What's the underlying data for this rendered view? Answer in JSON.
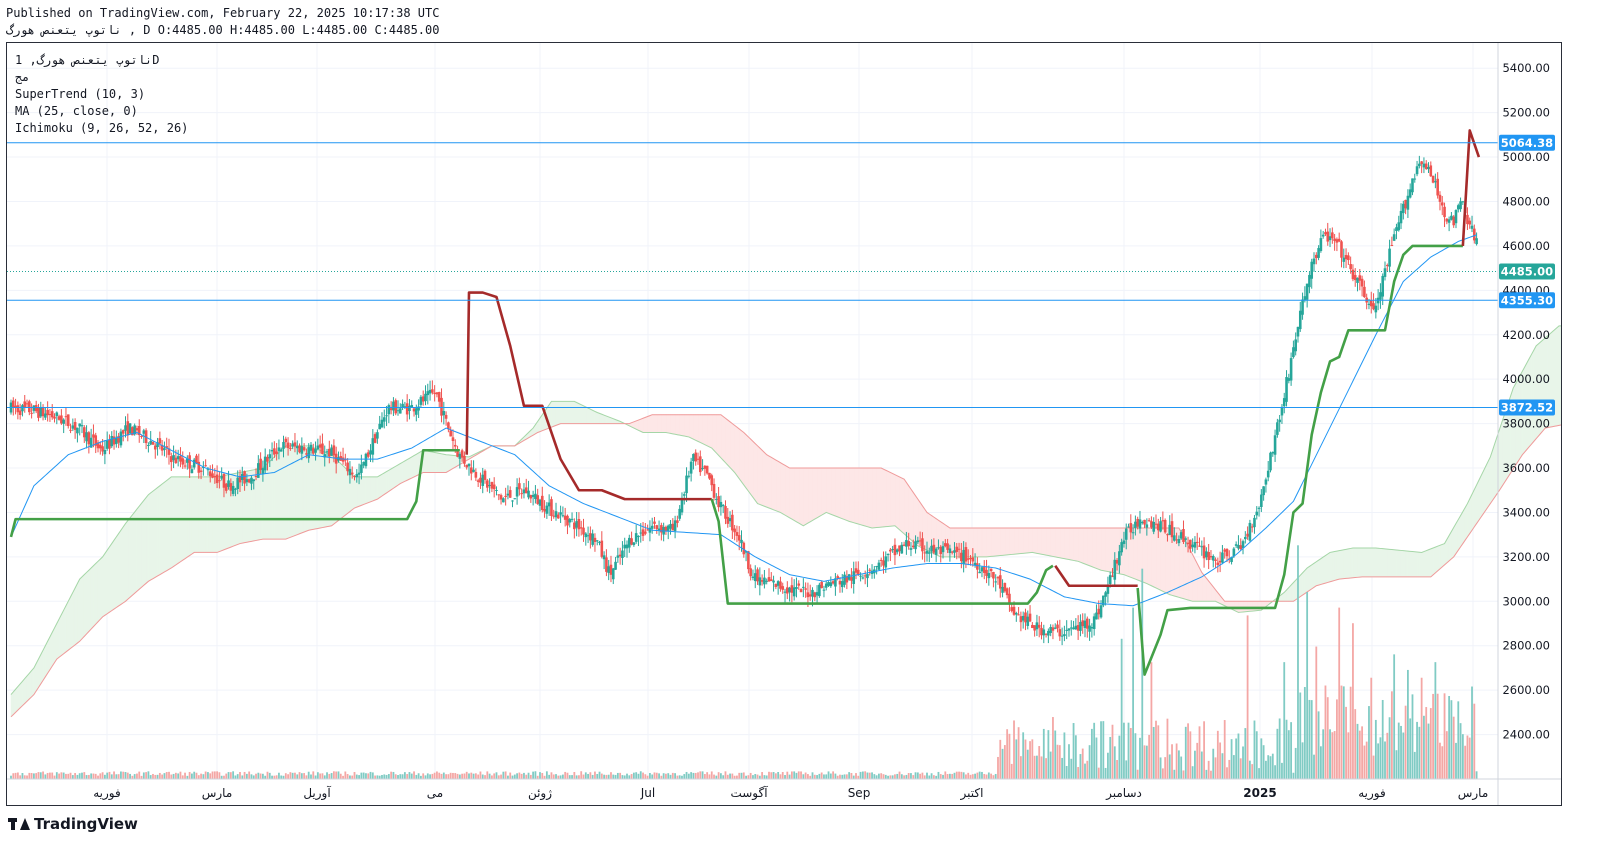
{
  "header": {
    "published": "Published on TradingView.com, February 22, 2025 10:17:38 UTC",
    "ohlc": "ناتوپ یتعنص هورگ , D O:4485.00 H:4485.00 L:4485.00 C:4485.00"
  },
  "legend": {
    "symbol": "ناتوپ یتعنص هورگ, 1D",
    "exchange": "مج",
    "supertrend": "SuperTrend (10, 3)",
    "ma": "MA (25, close, 0)",
    "ichimoku": "Ichimoku (9, 26, 52, 26)"
  },
  "footer": {
    "brand": "TradingView"
  },
  "colors": {
    "up": "#26a69a",
    "down": "#ef5350",
    "supertrend_up": "#43a047",
    "supertrend_down": "#a52a2a",
    "ma": "#2196f3",
    "cloud_bull": "#e8f5e9",
    "cloud_bear": "#fde7e7",
    "hline": "#2196f3"
  },
  "chart_data": {
    "type": "candlestick",
    "ylim": [
      2200,
      5500
    ],
    "y_ticks": [
      2400,
      2600,
      2800,
      3000,
      3200,
      3400,
      3600,
      3800,
      4000,
      4200,
      4400,
      4600,
      4800,
      5000,
      5200,
      5400
    ],
    "x_labels": [
      "فوریه",
      "مارس",
      "آوریل",
      "می",
      "ژوئن",
      "Jul",
      "آگوست",
      "Sep",
      "اکتبر",
      "دسامبر",
      "2025",
      "فوریه",
      "مارس"
    ],
    "x_label_bold": "2025",
    "horizontal_lines": [
      5064.38,
      4355.3,
      3872.52
    ],
    "price_labels": [
      {
        "value": 5064.38,
        "text": "5064.38",
        "color": "#2196f3"
      },
      {
        "value": 4485.0,
        "text": "4485.00",
        "color": "#26a69a"
      },
      {
        "value": 4355.3,
        "text": "4355.30",
        "color": "#2196f3"
      },
      {
        "value": 3872.52,
        "text": "3872.52",
        "color": "#2196f3"
      }
    ],
    "last_price": 4485.0,
    "price_anchors": [
      [
        0,
        3870
      ],
      [
        10,
        3860
      ],
      [
        20,
        3830
      ],
      [
        30,
        3780
      ],
      [
        40,
        3680
      ],
      [
        52,
        3780
      ],
      [
        62,
        3720
      ],
      [
        72,
        3640
      ],
      [
        85,
        3600
      ],
      [
        95,
        3520
      ],
      [
        105,
        3560
      ],
      [
        118,
        3700
      ],
      [
        128,
        3690
      ],
      [
        140,
        3670
      ],
      [
        152,
        3560
      ],
      [
        165,
        3870
      ],
      [
        175,
        3870
      ],
      [
        186,
        3940
      ],
      [
        190,
        3820
      ],
      [
        196,
        3660
      ],
      [
        205,
        3560
      ],
      [
        215,
        3460
      ],
      [
        225,
        3500
      ],
      [
        235,
        3420
      ],
      [
        245,
        3360
      ],
      [
        256,
        3280
      ],
      [
        262,
        3120
      ],
      [
        271,
        3280
      ],
      [
        281,
        3340
      ],
      [
        290,
        3320
      ],
      [
        298,
        3640
      ],
      [
        305,
        3560
      ],
      [
        310,
        3430
      ],
      [
        318,
        3300
      ],
      [
        325,
        3100
      ],
      [
        333,
        3080
      ],
      [
        342,
        3050
      ],
      [
        350,
        3040
      ],
      [
        358,
        3080
      ],
      [
        368,
        3110
      ],
      [
        380,
        3170
      ],
      [
        392,
        3260
      ],
      [
        402,
        3230
      ],
      [
        410,
        3220
      ],
      [
        418,
        3200
      ],
      [
        425,
        3150
      ],
      [
        432,
        3080
      ],
      [
        438,
        2950
      ],
      [
        448,
        2880
      ],
      [
        458,
        2860
      ],
      [
        466,
        2880
      ],
      [
        474,
        2920
      ],
      [
        480,
        3080
      ],
      [
        486,
        3280
      ],
      [
        494,
        3380
      ],
      [
        502,
        3340
      ],
      [
        510,
        3300
      ],
      [
        520,
        3230
      ],
      [
        528,
        3180
      ],
      [
        538,
        3250
      ],
      [
        546,
        3450
      ],
      [
        556,
        3900
      ],
      [
        562,
        4220
      ],
      [
        568,
        4500
      ],
      [
        574,
        4650
      ],
      [
        580,
        4600
      ],
      [
        586,
        4480
      ],
      [
        596,
        4300
      ],
      [
        604,
        4620
      ],
      [
        612,
        4880
      ],
      [
        616,
        5000
      ],
      [
        622,
        4880
      ],
      [
        626,
        4760
      ],
      [
        630,
        4700
      ],
      [
        634,
        4800
      ],
      [
        640,
        4620
      ]
    ],
    "supertrend": [
      {
        "trend": "up",
        "points": [
          [
            0,
            3290
          ],
          [
            2,
            3370
          ],
          [
            173,
            3370
          ],
          [
            177,
            3450
          ],
          [
            180,
            3680
          ],
          [
            196,
            3680
          ]
        ]
      },
      {
        "trend": "down",
        "points": [
          [
            199,
            3660
          ],
          [
            200,
            4390
          ],
          [
            206,
            4390
          ],
          [
            212,
            4370
          ],
          [
            218,
            4150
          ],
          [
            224,
            3880
          ],
          [
            232,
            3880
          ],
          [
            240,
            3640
          ],
          [
            248,
            3500
          ],
          [
            258,
            3500
          ],
          [
            268,
            3460
          ],
          [
            306,
            3460
          ]
        ]
      },
      {
        "trend": "up",
        "points": [
          [
            306,
            3460
          ],
          [
            309,
            3360
          ],
          [
            313,
            2990
          ],
          [
            444,
            2990
          ],
          [
            448,
            3040
          ],
          [
            452,
            3140
          ],
          [
            455,
            3160
          ]
        ]
      },
      {
        "trend": "down",
        "points": [
          [
            456,
            3160
          ],
          [
            462,
            3070
          ],
          [
            492,
            3070
          ]
        ]
      },
      {
        "trend": "up",
        "points": [
          [
            492,
            3060
          ],
          [
            495,
            2670
          ],
          [
            502,
            2850
          ],
          [
            505,
            2960
          ],
          [
            515,
            2970
          ],
          [
            552,
            2970
          ],
          [
            556,
            3120
          ],
          [
            560,
            3400
          ],
          [
            564,
            3440
          ],
          [
            568,
            3750
          ],
          [
            572,
            3940
          ],
          [
            576,
            4080
          ],
          [
            580,
            4100
          ],
          [
            584,
            4220
          ],
          [
            600,
            4220
          ],
          [
            604,
            4440
          ],
          [
            608,
            4560
          ],
          [
            612,
            4600
          ],
          [
            632,
            4600
          ],
          [
            634,
            4600
          ]
        ]
      },
      {
        "trend": "down",
        "points": [
          [
            634,
            4600
          ],
          [
            637,
            5120
          ],
          [
            641,
            5000
          ]
        ]
      }
    ],
    "ma_anchors": [
      [
        0,
        3290
      ],
      [
        10,
        3520
      ],
      [
        25,
        3660
      ],
      [
        40,
        3720
      ],
      [
        55,
        3760
      ],
      [
        70,
        3680
      ],
      [
        85,
        3600
      ],
      [
        100,
        3560
      ],
      [
        115,
        3580
      ],
      [
        130,
        3660
      ],
      [
        145,
        3640
      ],
      [
        160,
        3640
      ],
      [
        175,
        3690
      ],
      [
        190,
        3780
      ],
      [
        205,
        3720
      ],
      [
        220,
        3660
      ],
      [
        235,
        3520
      ],
      [
        250,
        3440
      ],
      [
        265,
        3380
      ],
      [
        280,
        3320
      ],
      [
        295,
        3310
      ],
      [
        310,
        3300
      ],
      [
        325,
        3200
      ],
      [
        340,
        3120
      ],
      [
        355,
        3090
      ],
      [
        370,
        3120
      ],
      [
        385,
        3150
      ],
      [
        400,
        3170
      ],
      [
        415,
        3170
      ],
      [
        430,
        3150
      ],
      [
        445,
        3100
      ],
      [
        460,
        3020
      ],
      [
        475,
        2990
      ],
      [
        490,
        2980
      ],
      [
        505,
        3040
      ],
      [
        520,
        3110
      ],
      [
        535,
        3210
      ],
      [
        548,
        3330
      ],
      [
        560,
        3450
      ],
      [
        572,
        3700
      ],
      [
        584,
        3950
      ],
      [
        596,
        4200
      ],
      [
        608,
        4440
      ],
      [
        620,
        4550
      ],
      [
        632,
        4620
      ],
      [
        640,
        4650
      ]
    ],
    "cloud_a_anchors": [
      [
        0,
        2580
      ],
      [
        10,
        2700
      ],
      [
        20,
        2900
      ],
      [
        30,
        3100
      ],
      [
        40,
        3200
      ],
      [
        50,
        3350
      ],
      [
        60,
        3480
      ],
      [
        70,
        3560
      ],
      [
        80,
        3560
      ],
      [
        90,
        3560
      ],
      [
        100,
        3580
      ],
      [
        110,
        3600
      ],
      [
        120,
        3700
      ],
      [
        130,
        3700
      ],
      [
        140,
        3660
      ],
      [
        150,
        3560
      ],
      [
        160,
        3560
      ],
      [
        170,
        3620
      ],
      [
        180,
        3680
      ],
      [
        190,
        3660
      ],
      [
        200,
        3650
      ],
      [
        210,
        3700
      ],
      [
        220,
        3700
      ],
      [
        228,
        3780
      ],
      [
        236,
        3900
      ],
      [
        246,
        3900
      ],
      [
        256,
        3850
      ],
      [
        266,
        3810
      ],
      [
        276,
        3760
      ],
      [
        286,
        3760
      ],
      [
        296,
        3740
      ],
      [
        306,
        3690
      ],
      [
        316,
        3580
      ],
      [
        326,
        3440
      ],
      [
        336,
        3400
      ],
      [
        346,
        3340
      ],
      [
        356,
        3400
      ],
      [
        366,
        3360
      ],
      [
        376,
        3330
      ],
      [
        386,
        3340
      ],
      [
        396,
        3250
      ],
      [
        406,
        3200
      ],
      [
        416,
        3200
      ],
      [
        426,
        3200
      ],
      [
        436,
        3210
      ],
      [
        446,
        3220
      ],
      [
        456,
        3200
      ],
      [
        466,
        3180
      ],
      [
        476,
        3140
      ],
      [
        486,
        3120
      ],
      [
        496,
        3080
      ],
      [
        506,
        3030
      ],
      [
        516,
        3000
      ],
      [
        526,
        3000
      ],
      [
        536,
        2950
      ],
      [
        546,
        2960
      ],
      [
        556,
        3040
      ],
      [
        566,
        3150
      ],
      [
        576,
        3220
      ],
      [
        586,
        3240
      ],
      [
        596,
        3240
      ],
      [
        606,
        3230
      ],
      [
        616,
        3220
      ],
      [
        626,
        3260
      ],
      [
        636,
        3440
      ],
      [
        646,
        3650
      ],
      [
        656,
        3960
      ],
      [
        666,
        4150
      ],
      [
        676,
        4240
      ],
      [
        680,
        4240
      ]
    ],
    "cloud_b_anchors": [
      [
        0,
        2480
      ],
      [
        10,
        2580
      ],
      [
        20,
        2740
      ],
      [
        30,
        2820
      ],
      [
        40,
        2930
      ],
      [
        50,
        3000
      ],
      [
        60,
        3090
      ],
      [
        70,
        3150
      ],
      [
        80,
        3220
      ],
      [
        90,
        3220
      ],
      [
        100,
        3260
      ],
      [
        110,
        3280
      ],
      [
        120,
        3280
      ],
      [
        130,
        3320
      ],
      [
        140,
        3340
      ],
      [
        150,
        3420
      ],
      [
        160,
        3460
      ],
      [
        170,
        3530
      ],
      [
        180,
        3580
      ],
      [
        190,
        3580
      ],
      [
        200,
        3640
      ],
      [
        210,
        3700
      ],
      [
        220,
        3700
      ],
      [
        230,
        3760
      ],
      [
        240,
        3800
      ],
      [
        250,
        3800
      ],
      [
        260,
        3800
      ],
      [
        270,
        3800
      ],
      [
        280,
        3840
      ],
      [
        290,
        3840
      ],
      [
        300,
        3840
      ],
      [
        310,
        3840
      ],
      [
        320,
        3760
      ],
      [
        330,
        3660
      ],
      [
        340,
        3600
      ],
      [
        350,
        3600
      ],
      [
        360,
        3600
      ],
      [
        370,
        3600
      ],
      [
        380,
        3600
      ],
      [
        390,
        3550
      ],
      [
        400,
        3400
      ],
      [
        410,
        3330
      ],
      [
        420,
        3330
      ],
      [
        430,
        3330
      ],
      [
        440,
        3330
      ],
      [
        450,
        3330
      ],
      [
        460,
        3330
      ],
      [
        470,
        3330
      ],
      [
        480,
        3330
      ],
      [
        490,
        3330
      ],
      [
        500,
        3330
      ],
      [
        510,
        3330
      ],
      [
        520,
        3130
      ],
      [
        530,
        3000
      ],
      [
        540,
        3000
      ],
      [
        550,
        3000
      ],
      [
        560,
        3000
      ],
      [
        570,
        3070
      ],
      [
        580,
        3100
      ],
      [
        590,
        3110
      ],
      [
        600,
        3110
      ],
      [
        610,
        3110
      ],
      [
        620,
        3110
      ],
      [
        630,
        3200
      ],
      [
        640,
        3350
      ],
      [
        650,
        3500
      ],
      [
        660,
        3660
      ],
      [
        670,
        3780
      ],
      [
        680,
        3800
      ]
    ],
    "volume_ylim": [
      0,
      3050
    ],
    "volume_spikes": [
      [
        485,
        1800
      ],
      [
        490,
        2200
      ],
      [
        494,
        2700
      ],
      [
        498,
        1500
      ],
      [
        540,
        2100
      ],
      [
        556,
        1500
      ],
      [
        562,
        3000
      ],
      [
        566,
        2400
      ],
      [
        570,
        1700
      ],
      [
        574,
        1200
      ],
      [
        580,
        2200
      ],
      [
        586,
        2000
      ],
      [
        594,
        1300
      ],
      [
        604,
        1600
      ],
      [
        610,
        1400
      ],
      [
        616,
        1300
      ],
      [
        622,
        1500
      ],
      [
        626,
        1100
      ],
      [
        630,
        800
      ]
    ]
  }
}
